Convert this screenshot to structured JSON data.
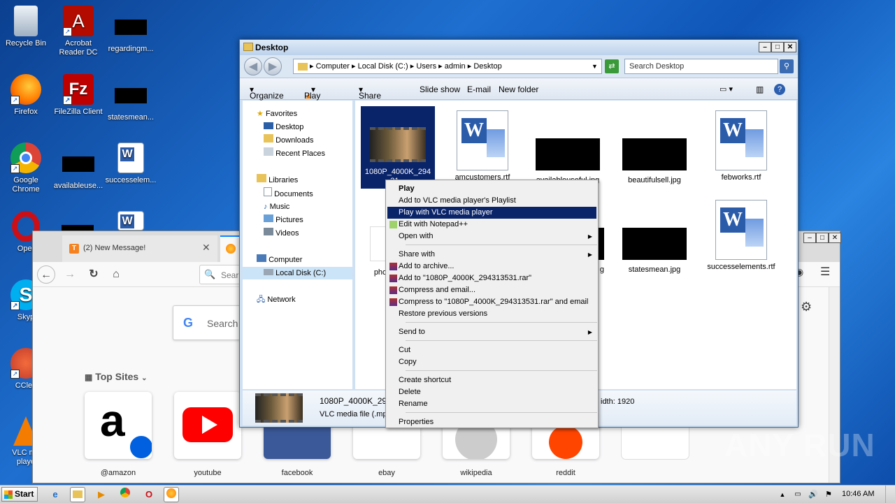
{
  "desktop": {
    "icons": [
      {
        "label": "Recycle Bin",
        "glyph": "🗑",
        "color": "#cfd8e0"
      },
      {
        "label": "Acrobat\nReader DC",
        "glyph": "A",
        "color": "#b30b00"
      },
      {
        "label": "regardingm..."
      },
      {
        "label": "Firefox",
        "glyph": "🦊",
        "color": "#ff7b00"
      },
      {
        "label": "FileZilla Client",
        "glyph": "Fz",
        "color": "#bf0000"
      },
      {
        "label": "statesmean..."
      },
      {
        "label": "Google\nChrome",
        "glyph": "●",
        "color": "#1e8e3e"
      },
      {
        "label": "availableuse..."
      },
      {
        "label": "successelem..."
      },
      {
        "label": "Oper",
        "glyph": "O",
        "color": "#cc0f16"
      },
      {
        "label": "Skyp",
        "glyph": "S",
        "color": "#00aff0"
      },
      {
        "label": "CClea",
        "glyph": "C",
        "color": "#e35a2b"
      },
      {
        "label": "VLC me\nplaye",
        "glyph": "▲",
        "color": "#f47c00"
      }
    ]
  },
  "firefox": {
    "tab_title": "(2) New Message!",
    "search_placeholder": "Sear",
    "google_search": "Search",
    "top_sites_label": "Top Sites",
    "sites": [
      "@amazon",
      "youtube",
      "facebook",
      "ebay",
      "wikipedia",
      "reddit"
    ]
  },
  "explorer": {
    "title": "Desktop",
    "breadcrumb": [
      "Computer",
      "Local Disk (C:)",
      "Users",
      "admin",
      "Desktop"
    ],
    "search_placeholder": "Search Desktop",
    "toolbar": [
      "Organize",
      "Play",
      "Share with",
      "Slide show",
      "E-mail",
      "New folder"
    ],
    "nav": {
      "favorites": "Favorites",
      "desktop": "Desktop",
      "downloads": "Downloads",
      "recent": "Recent Places",
      "libraries": "Libraries",
      "documents": "Documents",
      "music": "Music",
      "pictures": "Pictures",
      "videos": "Videos",
      "computer": "Computer",
      "localdisk": "Local Disk (C:)",
      "network": "Network"
    },
    "files": {
      "f1": "1080P_4000K_294\n31...",
      "f2": "amcustomers.rtf",
      "f3": "availableuseful.jpg",
      "f4": "beautifulsell.jpg",
      "f5": "febworks.rtf",
      "f6": "pho",
      "f7": "g",
      "f8": "statesmean.jpg",
      "f9": "successelements.rtf"
    },
    "details": {
      "name": "1080P_4000K_29",
      "type": "VLC media file (.mp4",
      "width": "idth: 1920"
    }
  },
  "context_menu": {
    "play": "Play",
    "add_playlist": "Add to VLC media player's Playlist",
    "play_vlc": "Play with VLC media player",
    "edit_npp": "Edit with Notepad++",
    "open_with": "Open with",
    "share_with": "Share with",
    "add_archive": "Add to archive...",
    "add_rar": "Add to \"1080P_4000K_294313531.rar\"",
    "compress_email": "Compress and email...",
    "compress_rar_email": "Compress to \"1080P_4000K_294313531.rar\" and email",
    "restore": "Restore previous versions",
    "send_to": "Send to",
    "cut": "Cut",
    "copy": "Copy",
    "create_shortcut": "Create shortcut",
    "delete": "Delete",
    "rename": "Rename",
    "properties": "Properties"
  },
  "taskbar": {
    "start": "Start",
    "time": "10:46 AM"
  },
  "watermark": "ANY RUN"
}
